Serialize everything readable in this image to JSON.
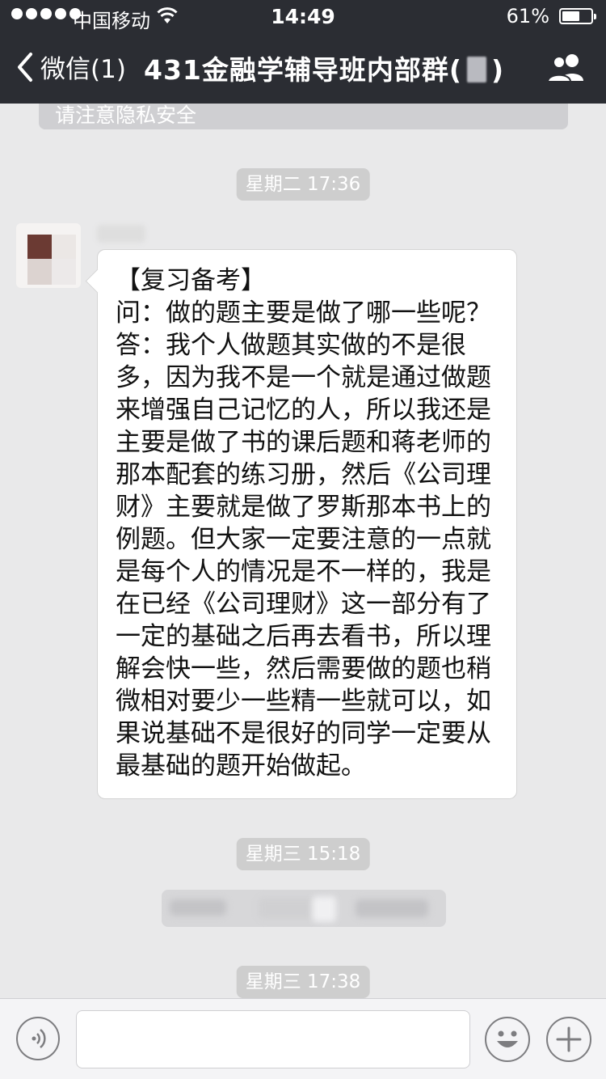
{
  "status_bar": {
    "carrier": "中国移动",
    "time": "14:49",
    "battery": "61%",
    "battery_level": 0.61
  },
  "nav": {
    "back_label": "微信(1)",
    "title_prefix": "431金融学辅导班内部群(",
    "title_suffix": ")"
  },
  "chat": {
    "system_notice": "请注意隐私安全",
    "timestamps": [
      "星期二 17:36",
      "星期三 15:18",
      "星期三 17:38"
    ],
    "message": {
      "lines": [
        "【复习备考】",
        "问：做的题主要是做了哪一些呢？",
        "答：我个人做题其实做的不是很",
        "多，因为我不是一个就是通过做题",
        "来增强自己记忆的人，所以我还是",
        "主要是做了书的课后题和蒋老师的",
        "那本配套的练习册，然后《公司理",
        "财》主要就是做了罗斯那本书上的",
        "例题。但大家一定要注意的一点就",
        "是每个人的情况是不一样的，我是",
        "在已经《公司理财》这一部分有了",
        "一定的基础之后再去看书，所以理",
        "解会快一些，然后需要做的题也稍",
        "微相对要少一些精一些就可以，如",
        "果说基础不是很好的同学一定要从",
        "最基础的题开始做起。"
      ]
    }
  },
  "input_bar": {
    "icons": [
      "voice-icon",
      "emoji-icon",
      "plus-icon"
    ]
  }
}
